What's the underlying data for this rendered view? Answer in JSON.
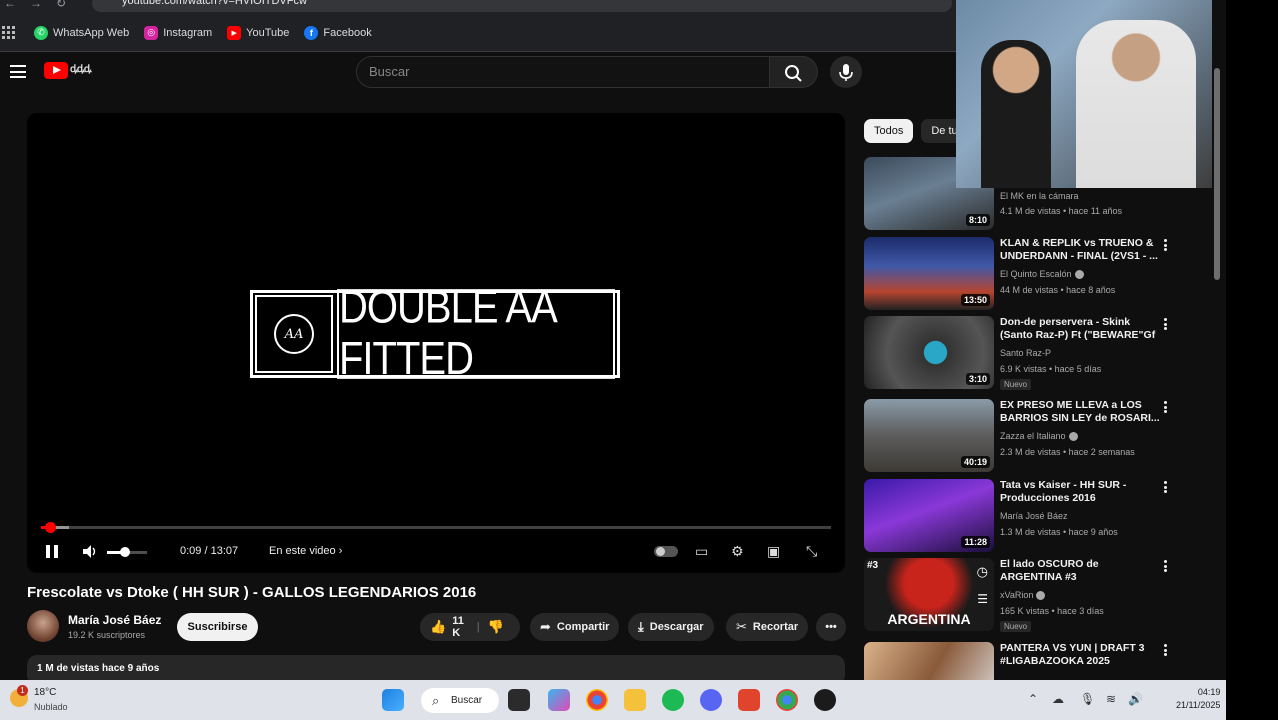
{
  "browser": {
    "url": "youtube.com/watch?v=HVIOITDVFcw",
    "bookmarks": [
      {
        "label": "WhatsApp Web",
        "color": "#25d366"
      },
      {
        "label": "Instagram",
        "color": "#d6249f"
      },
      {
        "label": "YouTube",
        "color": "#ff0000"
      },
      {
        "label": "Facebook",
        "color": "#1877f2"
      }
    ]
  },
  "header": {
    "search_placeholder": "Buscar"
  },
  "player": {
    "brand_text": "DOUBLE AA FITTED",
    "brand_emblem": "AA",
    "current_time": "0:09 / 13:07",
    "chapter_label": "En este video ›",
    "progress_fraction": 0.0115,
    "buffered_fraction": 0.035,
    "volume_fraction": 0.45
  },
  "video": {
    "title": "Frescolate vs Dtoke ( HH SUR ) - GALLOS LEGENDARIOS 2016",
    "channel": "María José Báez",
    "subscribers": "19.2 K suscriptores",
    "subscribe_label": "Suscribirse",
    "likes": "11 K",
    "share_label": "Compartir",
    "download_label": "Descargar",
    "clip_label": "Recortar",
    "views_line": "1 M de vistas  hace 9 años"
  },
  "sidebar": {
    "chips": [
      {
        "label": "Todos",
        "active": true
      },
      {
        "label": "De tu",
        "active": false
      }
    ],
    "recommendations": [
      {
        "title": "",
        "channel": "El MK en la cámara",
        "meta": "4.1 M de vistas • hace 11 años",
        "duration": "8:10",
        "verified": false,
        "badge": ""
      },
      {
        "title": "KLAN & REPLIK vs TRUENO & UNDERDANN - FINAL (2VS1 - ...",
        "channel": "El Quinto Escalón",
        "meta": "44 M de vistas • hace 8 años",
        "duration": "13:50",
        "verified": true,
        "badge": ""
      },
      {
        "title": "Don-de perservera - Skink (Santo Raz-P) Ft (\"BEWARE\"Gf - Track...",
        "channel": "Santo Raz-P",
        "meta": "6.9 K vistas • hace 5 días",
        "duration": "3:10",
        "verified": false,
        "badge": "Nuevo"
      },
      {
        "title": "EX PRESO ME LLEVA a LOS BARRIOS SIN LEY de ROSARI...",
        "channel": "Zazza el Italiano",
        "meta": "2.3 M de vistas • hace 2 semanas",
        "duration": "40:19",
        "verified": true,
        "badge": ""
      },
      {
        "title": "Tata vs Kaiser - HH SUR - Producciones 2016",
        "channel": "María José Báez",
        "meta": "1.3 M de vistas • hace 9 años",
        "duration": "11:28",
        "verified": false,
        "badge": ""
      },
      {
        "title": "El lado OSCURO de ARGENTINA #3",
        "channel": "xVaRion",
        "meta": "165 K vistas • hace 3 días",
        "duration": "",
        "verified": true,
        "badge": "Nuevo",
        "thumb_text": "ARGENTINA",
        "thumb_rank": "#3"
      },
      {
        "title": "PANTERA VS YUN | DRAFT 3 #LIGABAZOOKA 2025",
        "channel": "",
        "meta": "",
        "duration": "",
        "verified": false,
        "badge": ""
      }
    ]
  },
  "taskbar": {
    "temperature": "18°C",
    "condition": "Nublado",
    "weather_badge": "1",
    "search_label": "Buscar",
    "time": "04:19",
    "date": "21/11/2025"
  }
}
